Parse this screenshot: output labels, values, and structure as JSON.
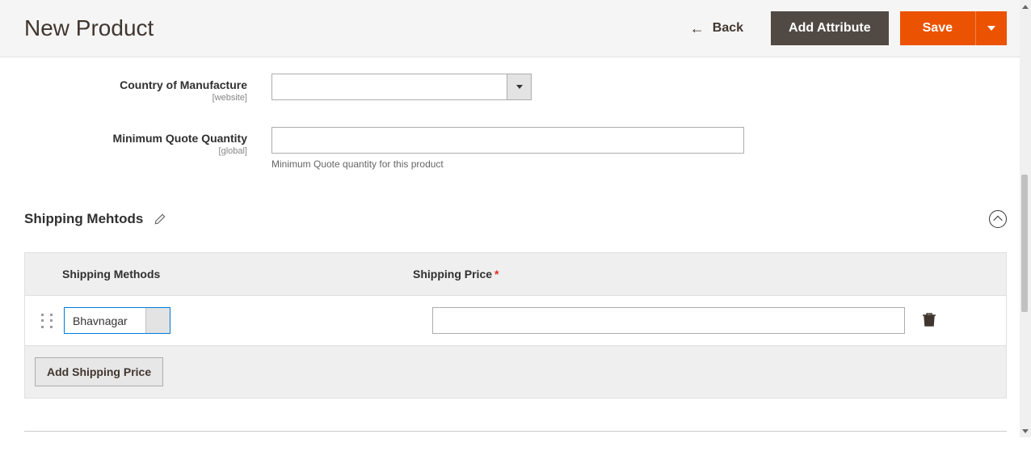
{
  "header": {
    "title": "New Product",
    "back_label": "Back",
    "add_attribute_label": "Add Attribute",
    "save_label": "Save"
  },
  "fields": {
    "country": {
      "label": "Country of Manufacture",
      "scope": "[website]",
      "value": ""
    },
    "min_quote": {
      "label": "Minimum Quote Quantity",
      "scope": "[global]",
      "value": "",
      "help": "Minimum Quote quantity for this product"
    }
  },
  "section": {
    "title": "Shipping Mehtods"
  },
  "table": {
    "headers": {
      "methods": "Shipping Methods",
      "price": "Shipping Price"
    },
    "rows": [
      {
        "method": "Bhavnagar",
        "price": ""
      }
    ],
    "add_button": "Add Shipping Price"
  }
}
